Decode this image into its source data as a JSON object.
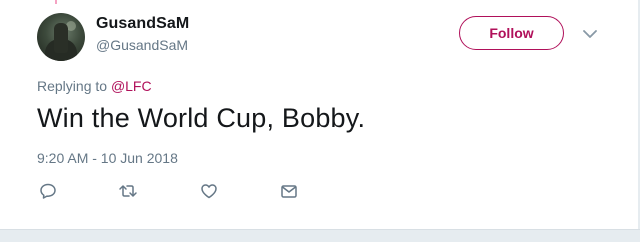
{
  "user": {
    "display_name": "GusandSaM",
    "handle": "@GusandSaM"
  },
  "follow_button": {
    "label": "Follow"
  },
  "reply_context": {
    "prefix": "Replying to ",
    "mention": "@LFC"
  },
  "tweet": {
    "text": "Win the World Cup, Bobby.",
    "timestamp": "9:20 AM - 10 Jun 2018"
  },
  "actions": [
    {
      "icon": "reply-icon"
    },
    {
      "icon": "retweet-icon"
    },
    {
      "icon": "like-icon"
    },
    {
      "icon": "direct-message-icon"
    }
  ],
  "colors": {
    "accent": "#b0105a",
    "text": "#14171a",
    "muted": "#657786",
    "background": "#ffffff",
    "divider": "#e6ecf0"
  }
}
